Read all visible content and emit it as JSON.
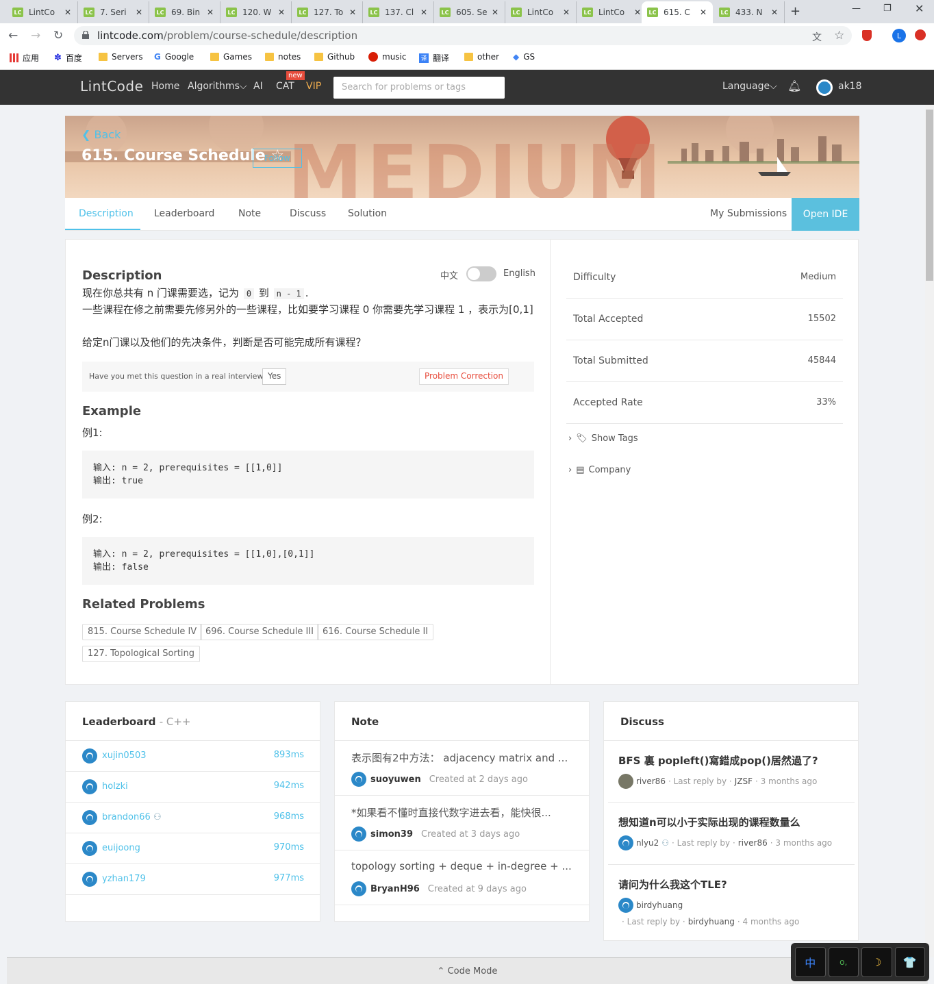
{
  "browser": {
    "tabs": [
      {
        "label": "LintCo",
        "icon": "LC"
      },
      {
        "label": "7. Seri",
        "icon": "LC"
      },
      {
        "label": "69. Bin",
        "icon": "LC"
      },
      {
        "label": "120. W",
        "icon": "LC"
      },
      {
        "label": "127. To",
        "icon": "LC"
      },
      {
        "label": "137. Cl",
        "icon": "LC"
      },
      {
        "label": "605. Se",
        "icon": "LC"
      },
      {
        "label": "LintCo",
        "icon": "LC"
      },
      {
        "label": "LintCo",
        "icon": "LC"
      },
      {
        "label": "615. C",
        "icon": "LC",
        "active": true
      },
      {
        "label": "433. N",
        "icon": "LC"
      }
    ],
    "new_tab": "+",
    "url_host": "lintcode.com",
    "url_path": "/problem/course-schedule/description",
    "profile_initial": "L",
    "bookmarks": [
      {
        "label": "应用",
        "icon": "apps-grid-icon"
      },
      {
        "label": "百度",
        "icon": "baidu-icon"
      },
      {
        "label": "Servers",
        "icon": "folder-icon"
      },
      {
        "label": "Google",
        "icon": "google-icon"
      },
      {
        "label": "Games",
        "icon": "folder-icon"
      },
      {
        "label": "notes",
        "icon": "folder-icon"
      },
      {
        "label": "Github",
        "icon": "folder-icon"
      },
      {
        "label": "music",
        "icon": "music-icon"
      },
      {
        "label": "翻译",
        "icon": "translate-icon"
      },
      {
        "label": "other",
        "icon": "folder-icon"
      },
      {
        "label": "GS",
        "icon": "scholar-icon"
      }
    ]
  },
  "site_nav": {
    "logo": "LintCode",
    "links": [
      "Home",
      "Algorithms",
      "AI",
      "CAT",
      "VIP"
    ],
    "new_badge": "new",
    "search_placeholder": "Search for problems or tags",
    "language": "Language",
    "username": "ak18"
  },
  "banner": {
    "back": "Back",
    "title": "615. Course Schedule",
    "follow": "Follow",
    "difficulty_watermark": "MEDIUM"
  },
  "problem_tabs": [
    "Description",
    "Leaderboard",
    "Note",
    "Discuss",
    "Solution"
  ],
  "my_submissions": "My Submissions",
  "open_ide": "Open IDE",
  "description": {
    "heading": "Description",
    "lang_cn": "中文",
    "lang_en": "English",
    "line1_a": "现在你总共有 n 门课需要选，记为",
    "line1_code1": "0",
    "line1_b": "到",
    "line1_code2": "n - 1",
    "line1_c": ".",
    "line2": "一些课程在修之前需要先修另外的一些课程，比如要学习课程 0 你需要先学习课程 1 ，表示为[0,1]",
    "line3": "给定n门课以及他们的先决条件，判断是否可能完成所有课程？",
    "interview_q": "Have you met this question in a real interview?",
    "interview_yes": "Yes",
    "correction": "Problem Correction",
    "example_heading": "Example",
    "ex1_label": "例1:",
    "ex1_code": "输入: n = 2, prerequisites = [[1,0]]\n输出: true",
    "ex2_label": "例2:",
    "ex2_code": "输入: n = 2, prerequisites = [[1,0],[0,1]]\n输出: false",
    "related_heading": "Related Problems",
    "related": [
      "815. Course Schedule IV",
      "696. Course Schedule III",
      "616. Course Schedule II",
      "127. Topological Sorting"
    ]
  },
  "stats": [
    {
      "label": "Difficulty",
      "value": "Medium"
    },
    {
      "label": "Total Accepted",
      "value": "15502"
    },
    {
      "label": "Total Submitted",
      "value": "45844"
    },
    {
      "label": "Accepted Rate",
      "value": "33%"
    }
  ],
  "show_tags": "Show Tags",
  "company": "Company",
  "leaderboard": {
    "title": "Leaderboard",
    "lang": "- C++",
    "rows": [
      {
        "user": "xujin0503",
        "time": "893ms"
      },
      {
        "user": "holzki",
        "time": "942ms"
      },
      {
        "user": "brandon66",
        "time": "968ms"
      },
      {
        "user": "euijoong",
        "time": "970ms"
      },
      {
        "user": "yzhan179",
        "time": "977ms"
      }
    ]
  },
  "notes": {
    "title": "Note",
    "items": [
      {
        "text": "表示图有2中方法： adjacency matrix and ...",
        "user": "suoyuwen",
        "created": "Created at 2 days ago"
      },
      {
        "text": "*如果看不懂时直接代数字进去看，能快很...",
        "user": "simon39",
        "created": "Created at 3 days ago"
      },
      {
        "text": "topology sorting + deque + in-degree + ...",
        "user": "BryanH96",
        "created": "Created at 9 days ago"
      }
    ]
  },
  "discuss": {
    "title": "Discuss",
    "items": [
      {
        "title": "BFS 裏 popleft()寫錯成pop()居然過了?",
        "user": "river86",
        "last": "· Last reply by ·",
        "reply_user": "JZSF",
        "ago": "· 3 months ago"
      },
      {
        "title": "想知道n可以小于实际出现的课程数量么",
        "user": "nlyu2",
        "last": "· Last reply by ·",
        "reply_user": "river86",
        "ago": "· 3 months ago"
      },
      {
        "title": "请问为什么我这个TLE?",
        "user": "birdyhuang",
        "last": "· Last reply by ·",
        "reply_user": "birdyhuang",
        "ago": "· 4 months ago"
      }
    ]
  },
  "code_mode": "Code Mode",
  "ime": [
    "中",
    "o,",
    "☽",
    "👕"
  ],
  "colors": {
    "accent": "#4fc1e9",
    "nav_bg": "#333333",
    "vip": "#f0ad4e",
    "correction": "#e74c3c"
  }
}
